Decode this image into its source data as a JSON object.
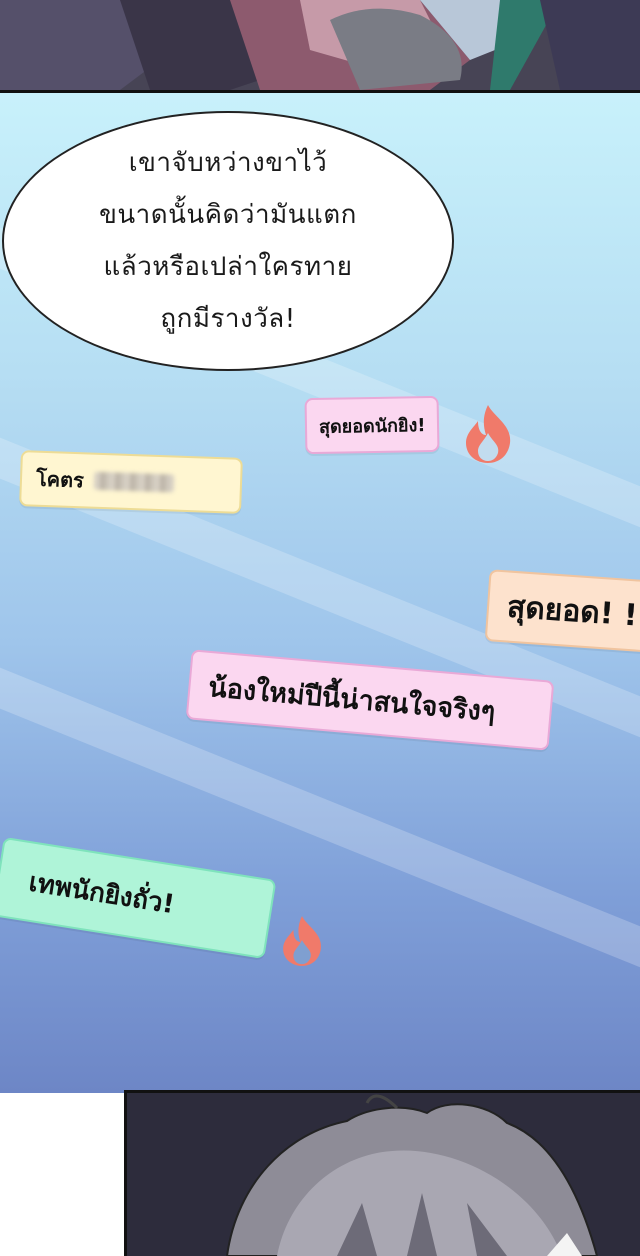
{
  "speech_bubble": {
    "lines": [
      "เขาจับหว่างขาไว้",
      "ขนาดนั้นคิดว่ามันแตก",
      "แล้วหรือเปล่าใครทาย",
      "ถูกมีรางวัล!"
    ]
  },
  "comments": {
    "pink_small": "สุดยอดนักยิง!",
    "yellow": "โคตร",
    "peach": "สุดยอด! !",
    "pink_large": "น้องใหม่ปีนี้น่าสนใจจริงๆ",
    "mint": "เทพนักยิงถั่ว!"
  },
  "colors": {
    "flame": "#f07a6a",
    "sky_top": "#c8f1fb",
    "sky_bottom": "#6d86c6"
  },
  "icons": {
    "flame": "flame-icon"
  }
}
